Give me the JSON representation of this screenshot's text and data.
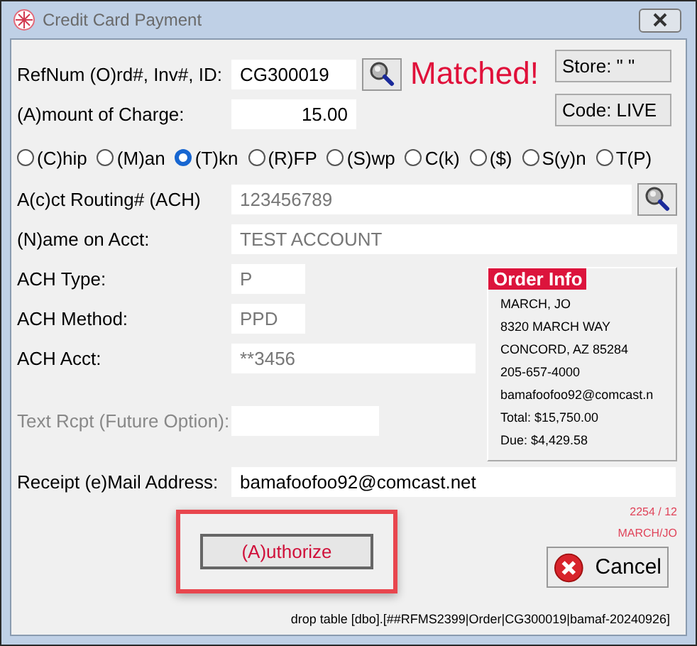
{
  "window": {
    "title": "Credit Card Payment"
  },
  "ref": {
    "label": "RefNum (O)rd#, Inv#, ID:",
    "value": "CG300019",
    "readonly": false
  },
  "match_status": "Matched!",
  "amount": {
    "label": "(A)mount of Charge:",
    "value": "15.00",
    "readonly": false
  },
  "side_buttons": [
    "Store: \" \"",
    "Code: LIVE"
  ],
  "payment_types": [
    {
      "label": "(C)hip",
      "selected": false
    },
    {
      "label": "(M)an",
      "selected": false
    },
    {
      "label": "(T)kn",
      "selected": true
    },
    {
      "label": "(R)FP",
      "selected": false
    },
    {
      "label": "(S)wp",
      "selected": false
    },
    {
      "label": "C(k)",
      "selected": false
    },
    {
      "label": "($)",
      "selected": false
    },
    {
      "label": "S(y)n",
      "selected": false
    },
    {
      "label": "T(P)",
      "selected": false
    }
  ],
  "routing": {
    "label": "A(c)ct Routing# (ACH)",
    "value": "123456789",
    "readonly": true
  },
  "name": {
    "label": "(N)ame on Acct:",
    "value": "TEST ACCOUNT",
    "readonly": true
  },
  "ach_type": {
    "label": "ACH Type:",
    "value": "P",
    "readonly": true
  },
  "ach_method": {
    "label": "ACH Method:",
    "value": "PPD",
    "readonly": true
  },
  "ach_acct": {
    "label": "ACH Acct:",
    "value": "**3456",
    "readonly": true
  },
  "text_receipt": {
    "label": "Text Rcpt (Future Option):",
    "disabled": true
  },
  "order_info": {
    "title": "Order Info",
    "lines": [
      "MARCH, JO",
      "8320 MARCH WAY",
      "CONCORD, AZ  85284",
      "205-657-4000",
      "bamafoofoo92@comcast.n",
      "Total: $15,750.00",
      "Due: $4,429.58"
    ]
  },
  "email": {
    "label": "Receipt (e)Mail Address:",
    "value": "bamafoofoo92@comcast.net",
    "readonly": false
  },
  "counters": [
    "2254 / 12",
    "MARCH/JO"
  ],
  "authorize_button": {
    "label": "(A)uthorize",
    "highlighted": true
  },
  "cancel_button": {
    "label": "Cancel"
  },
  "footer": "drop table [dbo].[##RFMS2399|Order|CG300019|bamaf-20240926]"
}
